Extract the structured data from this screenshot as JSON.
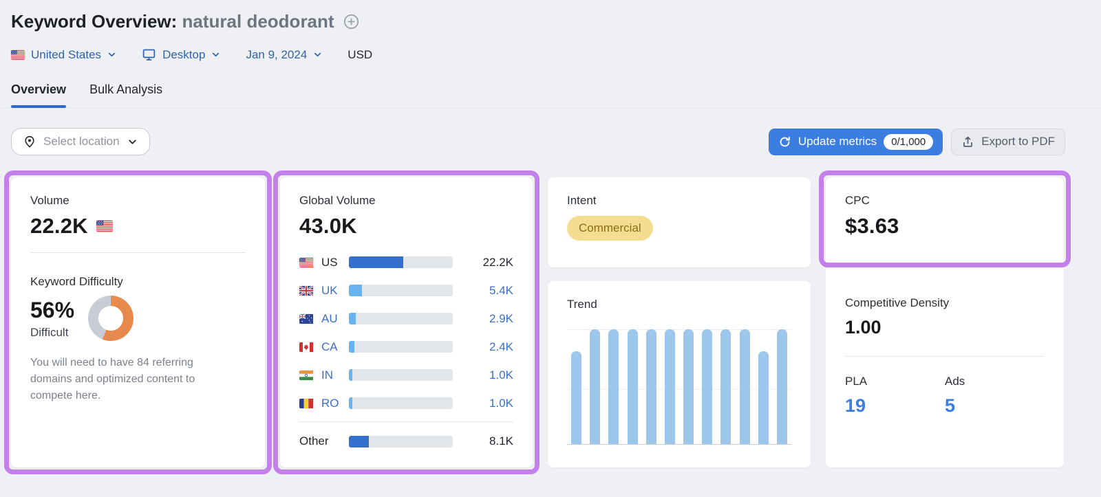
{
  "header": {
    "title_prefix": "Keyword Overview:",
    "title_keyword": "natural deodorant",
    "filters": {
      "country": "United States",
      "device": "Desktop",
      "date": "Jan 9, 2024",
      "currency": "USD"
    }
  },
  "tabs": [
    {
      "label": "Overview",
      "active": true
    },
    {
      "label": "Bulk Analysis",
      "active": false
    }
  ],
  "toolbar": {
    "select_location_placeholder": "Select location",
    "update_metrics_label": "Update metrics",
    "update_metrics_quota": "0/1,000",
    "export_pdf_label": "Export to PDF"
  },
  "volume": {
    "label": "Volume",
    "value": "22.2K",
    "flag": "us"
  },
  "keyword_difficulty": {
    "label": "Keyword Difficulty",
    "value": "56%",
    "percent": 56,
    "level": "Difficult",
    "description": "You will need to have 84 referring domains and optimized content to compete here."
  },
  "global_volume": {
    "label": "Global Volume",
    "value": "43.0K",
    "countries": [
      {
        "code": "US",
        "value": "22.2K",
        "share": 52,
        "flag": "us",
        "dark": true
      },
      {
        "code": "UK",
        "value": "5.4K",
        "share": 12.5,
        "flag": "uk",
        "dark": false
      },
      {
        "code": "AU",
        "value": "2.9K",
        "share": 6.7,
        "flag": "au",
        "dark": false
      },
      {
        "code": "CA",
        "value": "2.4K",
        "share": 5.6,
        "flag": "ca",
        "dark": false
      },
      {
        "code": "IN",
        "value": "1.0K",
        "share": 3.4,
        "flag": "in",
        "dark": false
      },
      {
        "code": "RO",
        "value": "1.0K",
        "share": 3.4,
        "flag": "ro",
        "dark": false
      }
    ],
    "other": {
      "label": "Other",
      "value": "8.1K",
      "share": 19
    }
  },
  "intent": {
    "label": "Intent",
    "badge": "Commercial"
  },
  "trend": {
    "label": "Trend"
  },
  "cpc": {
    "label": "CPC",
    "value": "$3.63"
  },
  "competitive_density": {
    "label": "Competitive Density",
    "value": "1.00"
  },
  "pla": {
    "label": "PLA",
    "value": "19"
  },
  "ads": {
    "label": "Ads",
    "value": "5"
  },
  "chart_data": [
    {
      "type": "bar",
      "title": "Trend",
      "subtitle": "Monthly search interest, 12 months, normalized",
      "values": [
        0.81,
        1,
        1,
        1,
        1,
        1,
        1,
        1,
        1,
        1,
        0.81,
        1
      ],
      "xlabel": "",
      "ylabel": "",
      "ylim": [
        0,
        1
      ],
      "grid": "faint horizontal lines at 1.0 and 0.5",
      "legend": "none",
      "bar_color": "#9cc6ea"
    },
    {
      "type": "pie",
      "title": "Keyword Difficulty donut",
      "labels": [
        "difficult",
        "remaining"
      ],
      "values": [
        56,
        44
      ],
      "colors": [
        "#e8894e",
        "#c9ccd4"
      ],
      "center_text": "56% Difficult"
    },
    {
      "type": "bar",
      "title": "Global Volume by country",
      "categories": [
        "US",
        "UK",
        "AU",
        "CA",
        "IN",
        "RO",
        "Other"
      ],
      "values": [
        22200,
        5400,
        2900,
        2400,
        1000,
        1000,
        8100
      ],
      "value_labels": [
        "22.2K",
        "5.4K",
        "2.9K",
        "2.4K",
        "1.0K",
        "1.0K",
        "8.1K"
      ],
      "total": 43000,
      "orientation": "horizontal",
      "xlim": [
        0,
        43000
      ]
    }
  ],
  "colors": {
    "page_bg": "#eef0f4",
    "card_bg": "#ffffff",
    "highlight_purple": "#c480ea",
    "title_dark": "#1e2126",
    "title_muted": "#6d757f",
    "link_blue": "#2f63ac",
    "value_blue": "#3a70c4",
    "bright_blue": "#3b7ee2",
    "btn_blue": "#3b7de0",
    "btn_gray_bg": "#e8eaed",
    "btn_gray_text": "#565d68",
    "tab_underline": "#3168c8",
    "text_dark": "#24272c",
    "text_gray": "#7b828d",
    "divider": "#e4e6e9",
    "bar_track": "#e2e5ea",
    "bar_dark": "#3370cd",
    "bar_light": "#66b3f0",
    "trend_bar": "#9cc6ea",
    "kd_arc": "#e8894e",
    "kd_rest": "#c9ccd4",
    "intent_bg": "#f5dd90",
    "intent_text": "#8a6d1a"
  }
}
